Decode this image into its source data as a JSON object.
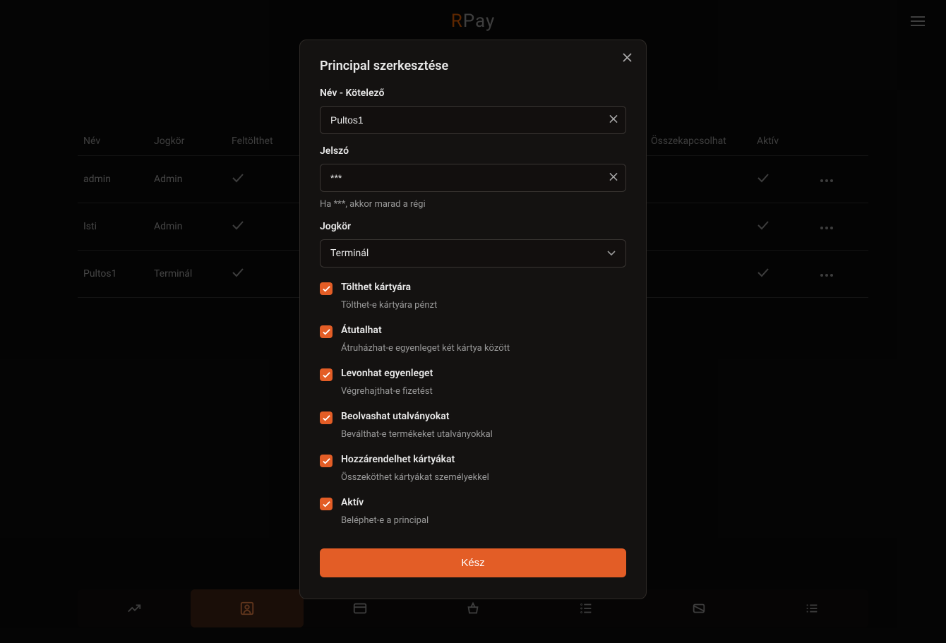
{
  "app": {
    "logo_a": "R",
    "logo_b": "Pay"
  },
  "table": {
    "headers": {
      "nev": "Név",
      "jogkor": "Jogkör",
      "feltolt": "Feltölthet",
      "osszek": "Összekapcsolhat",
      "aktiv": "Aktív"
    },
    "rows": [
      {
        "nev": "admin",
        "jogkor": "Admin"
      },
      {
        "nev": "Isti",
        "jogkor": "Admin"
      },
      {
        "nev": "Pultos1",
        "jogkor": "Terminál"
      }
    ]
  },
  "modal": {
    "title": "Principal szerkesztése",
    "name_label": "Név - Kötelező",
    "name_value": "Pultos1",
    "password_label": "Jelszó",
    "password_value": "***",
    "password_helper": "Ha ***, akkor marad a régi",
    "role_label": "Jogkör",
    "role_value": "Terminál",
    "checks": [
      {
        "label": "Tölthet kártyára",
        "desc": "Tölthet-e kártyára pénzt"
      },
      {
        "label": "Átutalhat",
        "desc": "Átruházhat-e egyenleget két kártya között"
      },
      {
        "label": "Levonhat egyenleget",
        "desc": "Végrehajthat-e fizetést"
      },
      {
        "label": "Beolvashat utalványokat",
        "desc": "Beválthat-e termékeket utalványokkal"
      },
      {
        "label": "Hozzárendelhet kártyákat",
        "desc": "Összeköthet kártyákat személyekkel"
      },
      {
        "label": "Aktív",
        "desc": "Beléphet-e a principal"
      }
    ],
    "submit": "Kész"
  }
}
